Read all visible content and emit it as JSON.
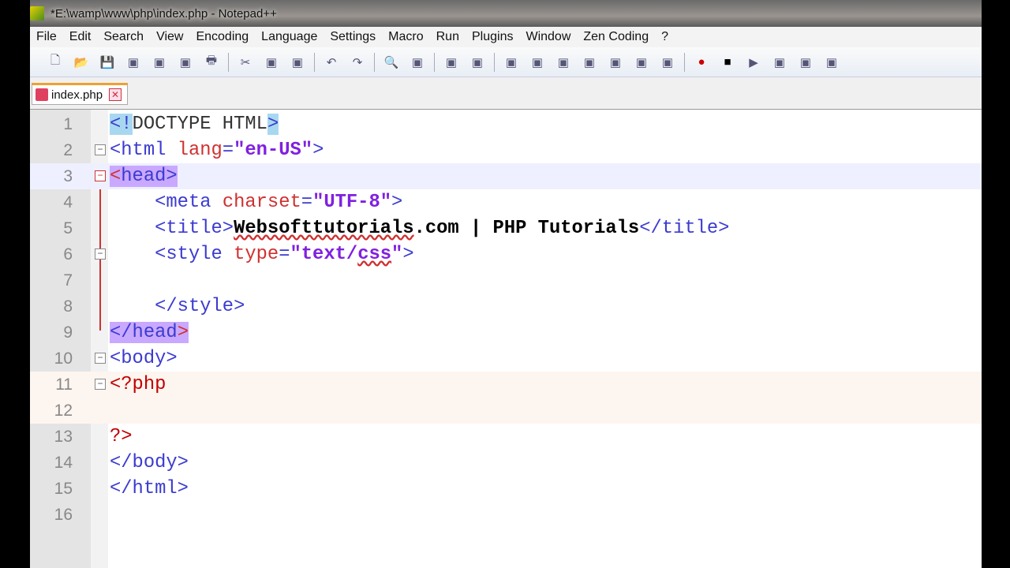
{
  "window": {
    "title": "*E:\\wamp\\www\\php\\index.php - Notepad++"
  },
  "menu": [
    "File",
    "Edit",
    "Search",
    "View",
    "Encoding",
    "Language",
    "Settings",
    "Macro",
    "Run",
    "Plugins",
    "Window",
    "Zen Coding",
    "?"
  ],
  "toolbar_icons": [
    "new-file",
    "open-file",
    "save",
    "save-all",
    "close",
    "close-all",
    "print",
    "cut",
    "copy",
    "paste",
    "undo",
    "redo",
    "find",
    "replace",
    "zoom-in",
    "zoom-out",
    "sync-vertical",
    "sync-horizontal",
    "word-wrap",
    "show-all-chars",
    "indent-guide",
    "user-defined-language",
    "doc-map",
    "record-macro",
    "stop-record",
    "play-macro",
    "run-macro-multiple",
    "save-macro",
    "plugin"
  ],
  "tab": {
    "label": "index.php"
  },
  "code": [
    {
      "n": "1",
      "tokens": [
        [
          "hlb t-tag",
          "<"
        ],
        [
          "hlb t-tag",
          "!"
        ],
        [
          "t-doc",
          "DOCTYPE HTML"
        ],
        [
          "hlb t-tag",
          ">"
        ]
      ]
    },
    {
      "n": "2",
      "fold": "box",
      "tokens": [
        [
          "t-tag",
          "<html "
        ],
        [
          "t-attr",
          "lang"
        ],
        [
          "t-tag",
          "="
        ],
        [
          "t-val",
          "\"en-US\""
        ],
        [
          "t-tag",
          ">"
        ]
      ]
    },
    {
      "n": "3",
      "fold": "red",
      "current": true,
      "tokens": [
        [
          "hl t-attr",
          "<"
        ],
        [
          "hl t-tag",
          "head>"
        ]
      ]
    },
    {
      "n": "4",
      "tokens": [
        [
          "t-tag",
          "    <meta "
        ],
        [
          "t-attr",
          "charset"
        ],
        [
          "t-tag",
          "="
        ],
        [
          "t-val",
          "\"UTF-8\""
        ],
        [
          "t-tag",
          ">"
        ]
      ]
    },
    {
      "n": "5",
      "tokens": [
        [
          "t-tag",
          "    <title>"
        ],
        [
          "t-text squig",
          "Websofttutorials"
        ],
        [
          "t-text",
          ".com | PHP Tutorials"
        ],
        [
          "t-tag",
          "</title>"
        ]
      ]
    },
    {
      "n": "6",
      "fold": "box",
      "tokens": [
        [
          "t-tag",
          "    <style "
        ],
        [
          "t-attr",
          "type"
        ],
        [
          "t-tag",
          "="
        ],
        [
          "t-val",
          "\"text/"
        ],
        [
          "t-val squig",
          "css"
        ],
        [
          "t-val",
          "\""
        ],
        [
          "t-tag",
          ">"
        ]
      ]
    },
    {
      "n": "7",
      "tokens": []
    },
    {
      "n": "8",
      "tokens": [
        [
          "t-tag",
          "    </style>"
        ]
      ]
    },
    {
      "n": "9",
      "tokens": [
        [
          "hl t-tag",
          "</head"
        ],
        [
          "hl t-attr",
          ">"
        ]
      ]
    },
    {
      "n": "10",
      "fold": "box",
      "tokens": [
        [
          "t-tag",
          "<body>"
        ]
      ]
    },
    {
      "n": "11",
      "fold": "box",
      "php": true,
      "tokens": [
        [
          "t-php",
          "<?php"
        ]
      ]
    },
    {
      "n": "12",
      "php": true,
      "tokens": []
    },
    {
      "n": "13",
      "tokens": [
        [
          "t-php",
          "?>"
        ]
      ]
    },
    {
      "n": "14",
      "tokens": [
        [
          "t-tag",
          "</body>"
        ]
      ]
    },
    {
      "n": "15",
      "tokens": [
        [
          "t-tag",
          "</html>"
        ]
      ]
    },
    {
      "n": "16",
      "tokens": []
    }
  ]
}
